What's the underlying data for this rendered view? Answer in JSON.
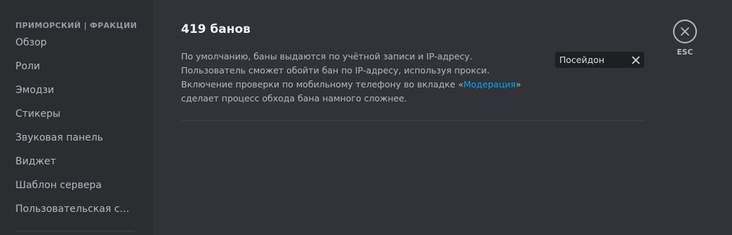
{
  "sidebar": {
    "header": "ПРИМОРСКИЙ | ФРАКЦИИ",
    "items": [
      {
        "label": "Обзор"
      },
      {
        "label": "Роли"
      },
      {
        "label": "Эмодзи"
      },
      {
        "label": "Стикеры"
      },
      {
        "label": "Звуковая панель"
      },
      {
        "label": "Виджет"
      },
      {
        "label": "Шаблон сервера"
      },
      {
        "label": "Пользовательская ссылка приглашения"
      }
    ]
  },
  "main": {
    "title": "419 банов",
    "description": {
      "text_before": "По умолчанию, баны выдаются по учётной записи и IP-адресу. Пользователь сможет обойти бан по IP-адресу, используя прокси. Включение проверки по мобильному телефону во вкладке «",
      "link": "Модерация",
      "text_after": "» сделает процесс обхода бана намного сложнее."
    },
    "search": {
      "value": "Посейдон",
      "clear_icon": "close-icon"
    }
  },
  "close": {
    "icon": "close-icon",
    "label": "ESC"
  },
  "colors": {
    "background": "#313338",
    "sidebar": "#2b2d31",
    "link": "#00a8fc",
    "input_bg": "#1e1f22"
  }
}
